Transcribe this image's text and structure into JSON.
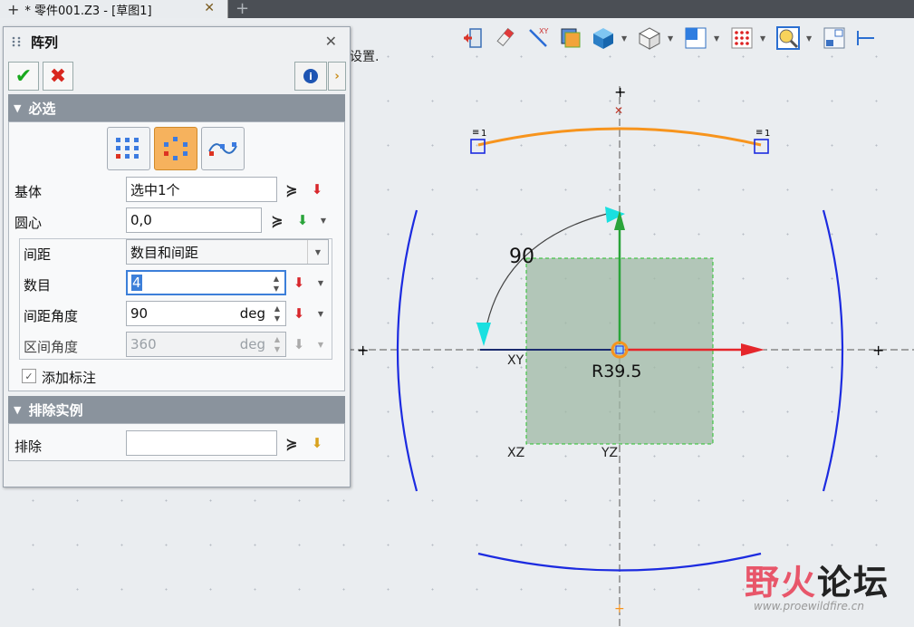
{
  "tab": {
    "title": "* 零件001.Z3 - [草图1]",
    "close": "✕",
    "new": "+"
  },
  "hint": "设置.",
  "panel": {
    "title": "阵列",
    "required_section": "必选",
    "fields": {
      "base": {
        "label": "基体",
        "value": "选中1个"
      },
      "center": {
        "label": "圆心",
        "value": "0,0"
      },
      "spacing": {
        "label": "间距",
        "value": "数目和间距"
      },
      "count": {
        "label": "数目",
        "value": "4"
      },
      "spacing_angle": {
        "label": "间距角度",
        "value": "90",
        "unit": "deg"
      },
      "range_angle": {
        "label": "区间角度",
        "value": "360",
        "unit": "deg"
      }
    },
    "add_annotation": "添加标注",
    "exclude_section": "排除实例",
    "exclude": {
      "label": "排除",
      "value": ""
    }
  },
  "sketch": {
    "angle_label": "90",
    "radius_label": "R39.5",
    "xy_label": "XY",
    "xz_label": "XZ",
    "yz_label": "YZ",
    "constraint_mark": "1"
  },
  "watermark": {
    "text1": "野火",
    "text2": "论坛",
    "url": "www.proewildfire.cn"
  },
  "colors": {
    "accent": "#f6b25d",
    "axis_x": "#e5262b",
    "axis_y": "#2aa43a",
    "arc": "#1c2be0",
    "highlight": "#f7941d"
  }
}
